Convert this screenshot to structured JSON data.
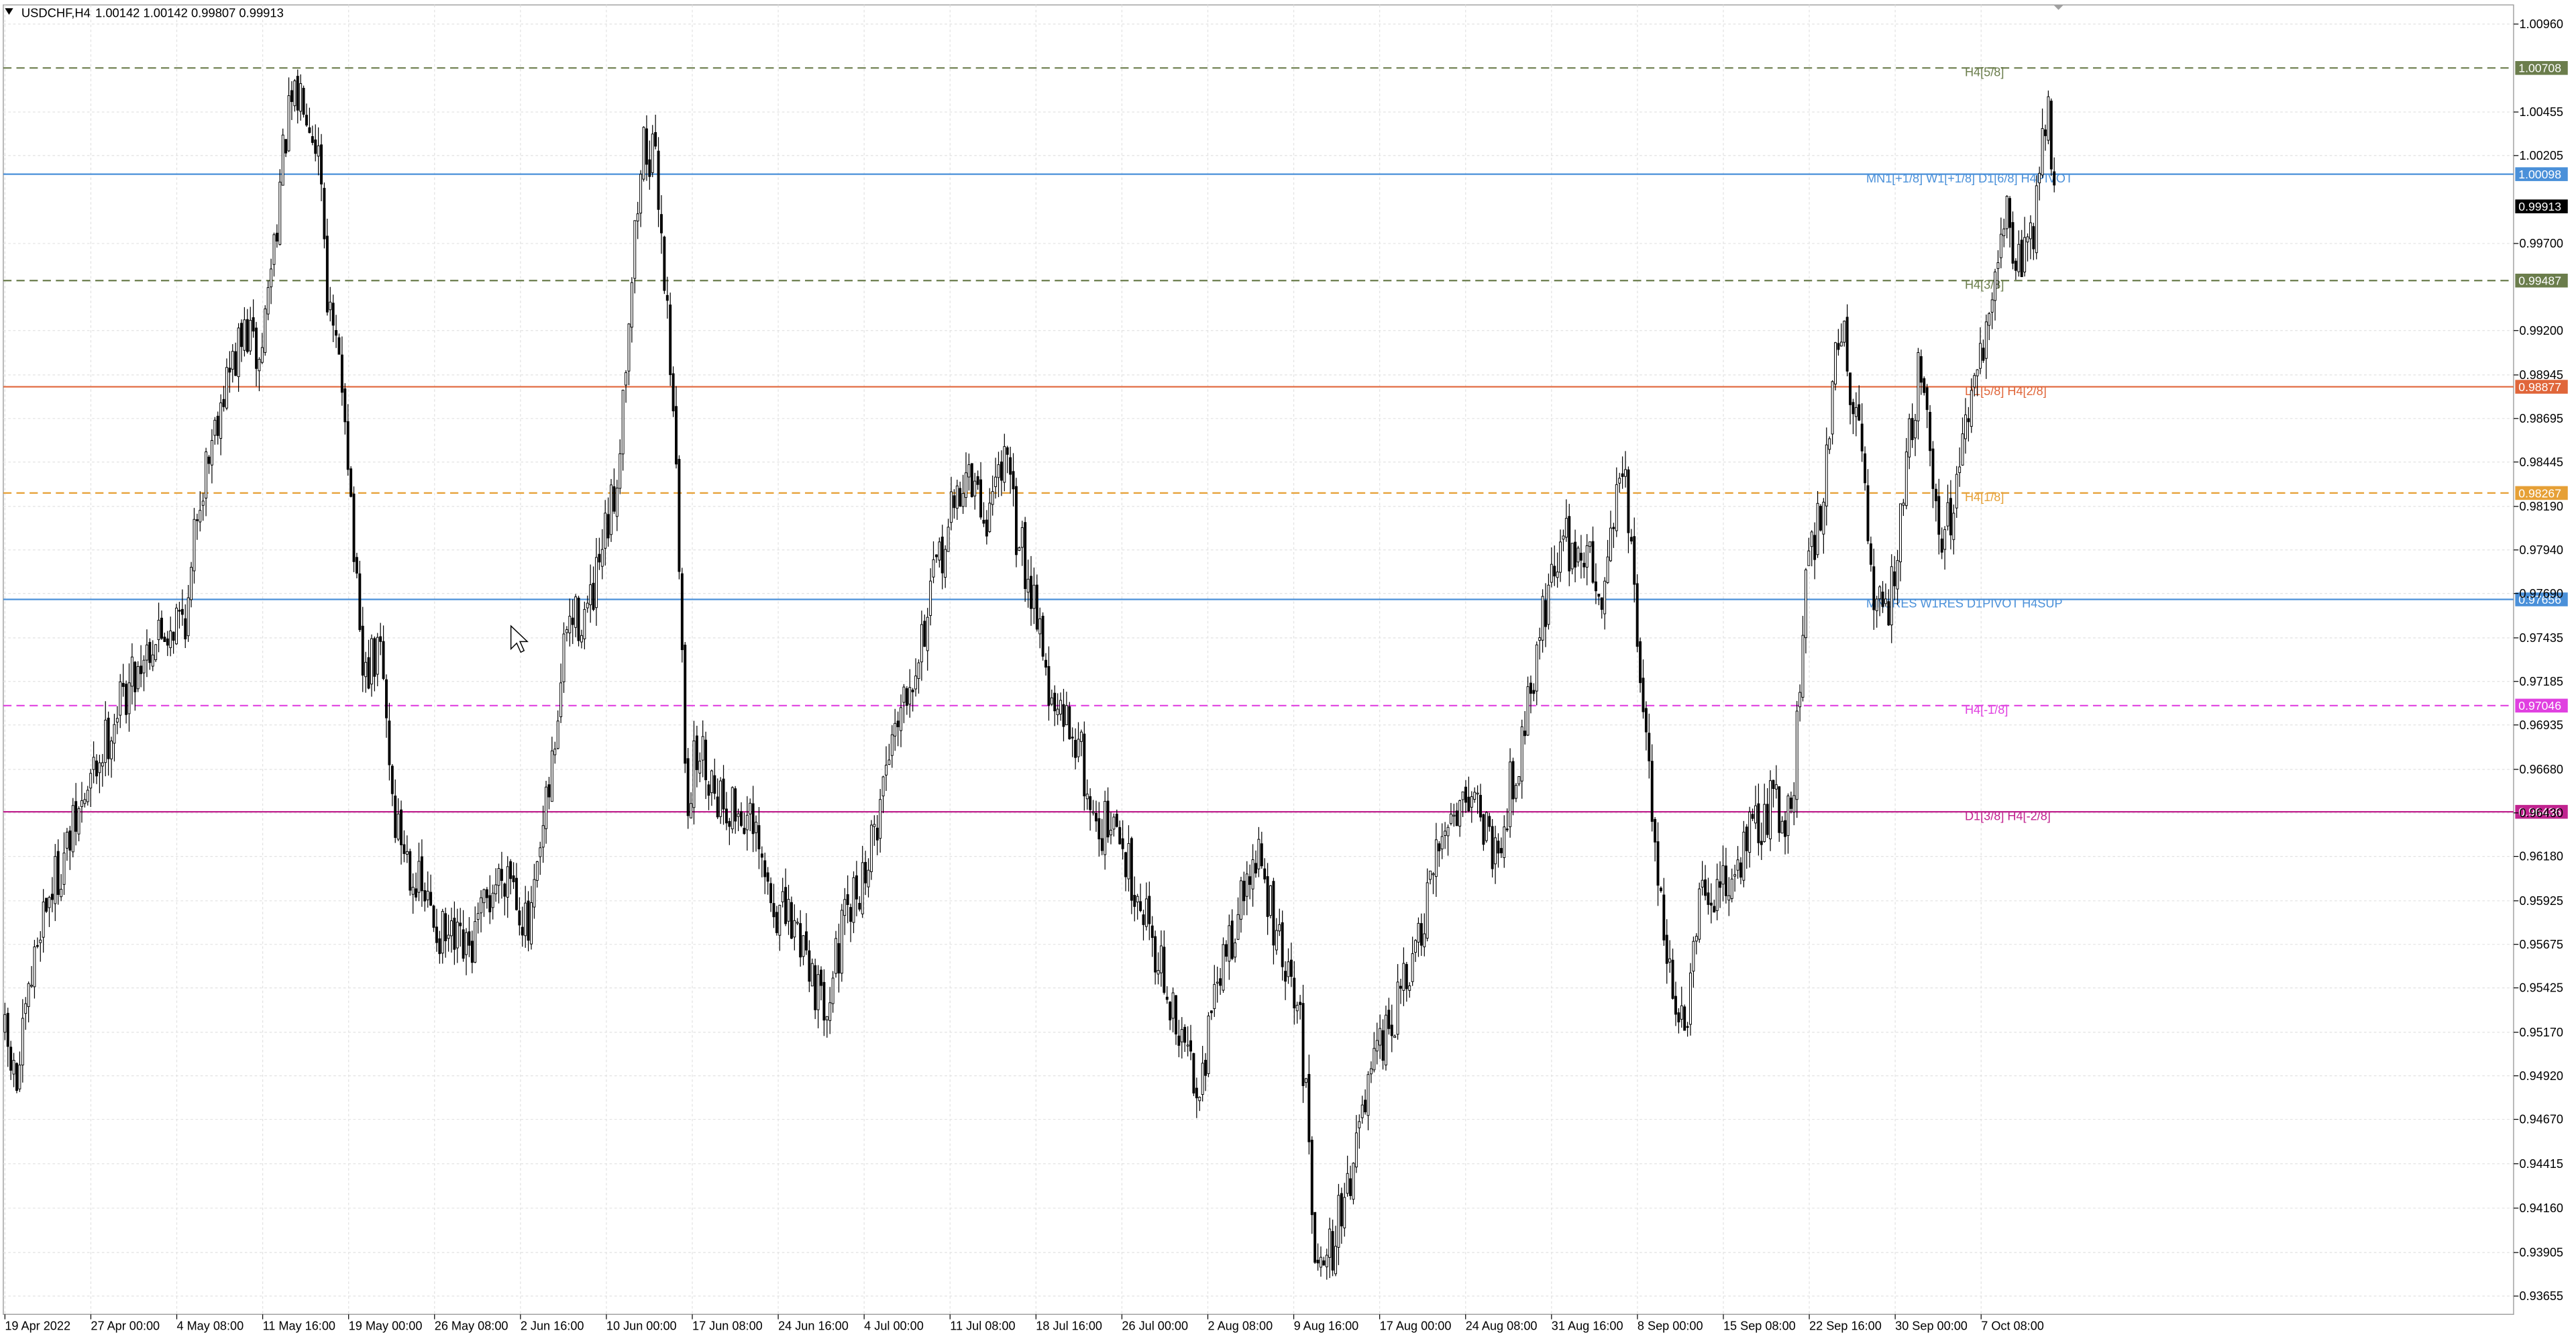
{
  "header": {
    "symbol_timeframe": "USDCHF,H4",
    "ohlc": "1.00142 1.00142 0.99807 0.99913",
    "menu_icon": "triangle-down-icon"
  },
  "colors": {
    "background": "#ffffff",
    "grid": "#e2e2e2",
    "candle": "#000000",
    "axis_text": "#000000",
    "current_price_bg": "#000000"
  },
  "chart_data": {
    "type": "candlestick",
    "symbol": "USDCHF",
    "timeframe": "H4",
    "y_axis": {
      "ticks": [
        "1.00960",
        "1.00455",
        "1.00205",
        "0.99700",
        "0.99200",
        "0.98945",
        "0.98695",
        "0.98445",
        "0.98190",
        "0.97940",
        "0.97690",
        "0.97435",
        "0.97185",
        "0.96935",
        "0.96680",
        "0.96430",
        "0.96180",
        "0.95925",
        "0.95675",
        "0.95425",
        "0.95170",
        "0.94920",
        "0.94670",
        "0.94415",
        "0.94160",
        "0.93905",
        "0.93655"
      ],
      "ylim": [
        0.9355,
        1.0107
      ]
    },
    "x_axis": {
      "ticks": [
        "19 Apr 2022",
        "27 Apr 00:00",
        "4 May 08:00",
        "11 May 16:00",
        "19 May 00:00",
        "26 May 08:00",
        "2 Jun 16:00",
        "10 Jun 00:00",
        "17 Jun 08:00",
        "24 Jun 16:00",
        "4 Jul 00:00",
        "11 Jul 08:00",
        "18 Jul 16:00",
        "26 Jul 00:00",
        "2 Aug 08:00",
        "9 Aug 16:00",
        "17 Aug 00:00",
        "24 Aug 08:00",
        "31 Aug 16:00",
        "8 Sep 00:00",
        "15 Sep 08:00",
        "22 Sep 16:00",
        "30 Sep 00:00",
        "7 Oct 08:00"
      ]
    },
    "current_price": "0.99913",
    "levels": [
      {
        "price": "1.00708",
        "label": "H4[5/8]",
        "color": "#6b7d4c",
        "style": "dashed"
      },
      {
        "price": "1.00098",
        "label": "MN1[+1/8] W1[+1/8] D1[6/8] H4PIVOT",
        "color": "#4a90d9",
        "style": "solid"
      },
      {
        "price": "0.99487",
        "label": "H4[3/8]",
        "color": "#6b7d4c",
        "style": "dashed"
      },
      {
        "price": "0.98877",
        "label": "D1[5/8] H4[2/8]",
        "color": "#e0663a",
        "style": "solid"
      },
      {
        "price": "0.98267",
        "label": "H4[1/8]",
        "color": "#e6a036",
        "style": "dashed"
      },
      {
        "price": "0.97656",
        "label": "MN1RES W1RES D1PIVOT H4SUP",
        "color": "#4a90d9",
        "style": "solid"
      },
      {
        "price": "0.97046",
        "label": "H4[-1/8]",
        "color": "#e040e0",
        "style": "dashed"
      },
      {
        "price": "0.96436",
        "label": "D1[3/8] H4[-2/8]",
        "color": "#c0238f",
        "style": "solid"
      }
    ],
    "path_anchors": [
      [
        0,
        0.9525
      ],
      [
        10,
        0.9485
      ],
      [
        25,
        0.9585
      ],
      [
        40,
        0.962
      ],
      [
        55,
        0.966
      ],
      [
        70,
        0.97
      ],
      [
        90,
        0.974
      ],
      [
        115,
        0.976
      ],
      [
        120,
        0.982
      ],
      [
        135,
        0.9885
      ],
      [
        150,
        0.992
      ],
      [
        158,
        0.99
      ],
      [
        175,
        1.004
      ],
      [
        185,
        1.006
      ],
      [
        195,
        1.002
      ],
      [
        200,
        0.993
      ],
      [
        210,
        0.988
      ],
      [
        220,
        0.972
      ],
      [
        232,
        0.9735
      ],
      [
        240,
        0.964
      ],
      [
        255,
        0.96
      ],
      [
        270,
        0.957
      ],
      [
        285,
        0.956
      ],
      [
        300,
        0.96
      ],
      [
        310,
        0.9615
      ],
      [
        322,
        0.957
      ],
      [
        335,
        0.966
      ],
      [
        345,
        0.975
      ],
      [
        360,
        0.976
      ],
      [
        375,
        0.983
      ],
      [
        385,
        0.996
      ],
      [
        392,
        1.003
      ],
      [
        400,
        1.001
      ],
      [
        410,
        0.988
      ],
      [
        418,
        0.965
      ],
      [
        425,
        0.968
      ],
      [
        440,
        0.965
      ],
      [
        455,
        0.964
      ],
      [
        470,
        0.959
      ],
      [
        490,
        0.957
      ],
      [
        500,
        0.953
      ],
      [
        515,
        0.958
      ],
      [
        530,
        0.962
      ],
      [
        545,
        0.97
      ],
      [
        560,
        0.974
      ],
      [
        575,
        0.98
      ],
      [
        588,
        0.984
      ],
      [
        600,
        0.981
      ],
      [
        610,
        0.985
      ],
      [
        620,
        0.98
      ],
      [
        632,
        0.976
      ],
      [
        640,
        0.97
      ],
      [
        655,
        0.969
      ],
      [
        665,
        0.964
      ],
      [
        680,
        0.963
      ],
      [
        700,
        0.958
      ],
      [
        715,
        0.952
      ],
      [
        730,
        0.949
      ],
      [
        745,
        0.956
      ],
      [
        765,
        0.962
      ],
      [
        780,
        0.956
      ],
      [
        792,
        0.952
      ],
      [
        800,
        0.94
      ],
      [
        810,
        0.939
      ],
      [
        820,
        0.943
      ],
      [
        835,
        0.949
      ],
      [
        850,
        0.953
      ],
      [
        865,
        0.957
      ],
      [
        880,
        0.964
      ],
      [
        895,
        0.966
      ],
      [
        910,
        0.962
      ],
      [
        925,
        0.968
      ],
      [
        940,
        0.976
      ],
      [
        950,
        0.98
      ],
      [
        965,
        0.979
      ],
      [
        975,
        0.977
      ],
      [
        988,
        0.985
      ],
      [
        995,
        0.976
      ],
      [
        1005,
        0.965
      ],
      [
        1015,
        0.956
      ],
      [
        1025,
        0.951
      ],
      [
        1035,
        0.959
      ],
      [
        1050,
        0.96
      ],
      [
        1065,
        0.963
      ],
      [
        1080,
        0.965
      ],
      [
        1090,
        0.964
      ],
      [
        1100,
        0.978
      ],
      [
        1110,
        0.983
      ],
      [
        1120,
        0.993
      ],
      [
        1130,
        0.987
      ],
      [
        1140,
        0.977
      ],
      [
        1150,
        0.976
      ],
      [
        1160,
        0.984
      ],
      [
        1170,
        0.991
      ],
      [
        1180,
        0.98
      ],
      [
        1190,
        0.982
      ],
      [
        1200,
        0.988
      ],
      [
        1210,
        0.992
      ],
      [
        1220,
        0.999
      ],
      [
        1228,
        0.996
      ],
      [
        1238,
        0.998
      ],
      [
        1246,
        1.005
      ],
      [
        1252,
        0.999
      ]
    ]
  }
}
